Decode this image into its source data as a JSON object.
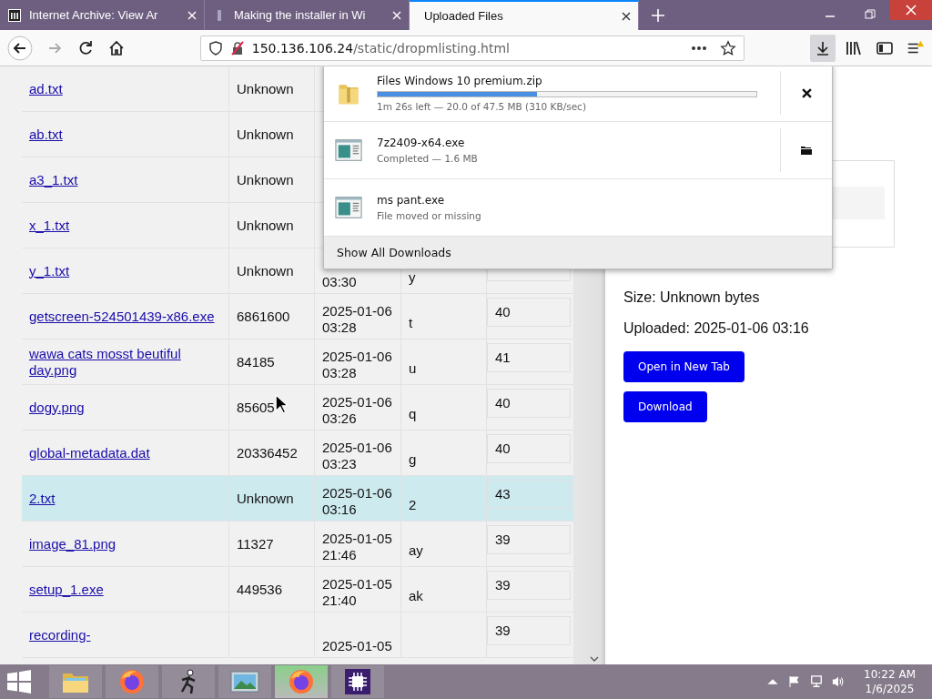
{
  "tabs": [
    {
      "title": "Internet Archive: View Ar",
      "selected": false
    },
    {
      "title": "Making the installer in Wi",
      "selected": false
    },
    {
      "title": "Uploaded Files",
      "selected": true
    }
  ],
  "address": {
    "host": "150.136.106.24",
    "path": "/static/dropmlisting.html"
  },
  "table": {
    "rows": [
      {
        "name": "ad.txt",
        "size": "Unknown",
        "selected": false
      },
      {
        "name": "ab.txt",
        "size": "Unknown",
        "selected": false
      },
      {
        "name": "a3_1.txt",
        "size": "Unknown",
        "selected": false
      },
      {
        "name": "x_1.txt",
        "size": "Unknown",
        "selected": false
      },
      {
        "name": "y_1.txt",
        "size": "Unknown",
        "date": "03:30",
        "type": "y",
        "selected": false
      },
      {
        "name": "getscreen-524501439-x86.exe",
        "size": "6861600",
        "date": "2025-01-06 03:28",
        "type": "t",
        "number": "40",
        "selected": false
      },
      {
        "name": "wawa cats mosst beutiful day.png",
        "size": "84185",
        "date": "2025-01-06 03:28",
        "type": "u",
        "number": "41",
        "selected": false
      },
      {
        "name": "dogy.png",
        "size": "85605",
        "date": "2025-01-06 03:26",
        "type": "q",
        "number": "40",
        "selected": false
      },
      {
        "name": "global-metadata.dat",
        "size": "20336452",
        "date": "2025-01-06 03:23",
        "type": "g",
        "number": "40",
        "selected": false
      },
      {
        "name": "2.txt",
        "size": "Unknown",
        "date": "2025-01-06 03:16",
        "type": "2",
        "number": "43",
        "selected": true
      },
      {
        "name": "image_81.png",
        "size": "11327",
        "date": "2025-01-05 21:46",
        "type": "ay",
        "number": "39",
        "selected": false
      },
      {
        "name": "setup_1.exe",
        "size": "449536",
        "date": "2025-01-05 21:40",
        "type": "ak",
        "number": "39",
        "selected": false
      },
      {
        "name": "recording-",
        "date": "2025-01-05",
        "number": "39",
        "selected": false
      }
    ]
  },
  "details": {
    "size": "Size: Unknown bytes",
    "uploaded": "Uploaded: 2025-01-06 03:16",
    "buttons": [
      "Open in New Tab",
      "Download"
    ]
  },
  "downloads": {
    "items": [
      {
        "name": "Files Windows 10 premium.zip",
        "status": "1m 26s left — 20.0 of 47.5 MB (310 KB/sec)",
        "kind": "downloading",
        "level": 0.42
      },
      {
        "name": "7z2409-x64.exe",
        "status": "Completed — 1.6 MB",
        "kind": "completed"
      },
      {
        "name": "ms pant.exe",
        "status": "File moved or missing",
        "kind": "missing"
      }
    ],
    "footer": "Show All Downloads"
  },
  "taskbar": {
    "apps": [
      {
        "kind": "explorer",
        "selected": false
      },
      {
        "kind": "firefox",
        "selected": false
      },
      {
        "kind": "runner",
        "selected": false
      },
      {
        "kind": "photos",
        "selected": false
      },
      {
        "kind": "firefox",
        "selected": true
      },
      {
        "kind": "chip",
        "selected": false
      }
    ],
    "time": "10:22 AM",
    "date": "1/6/2025"
  }
}
